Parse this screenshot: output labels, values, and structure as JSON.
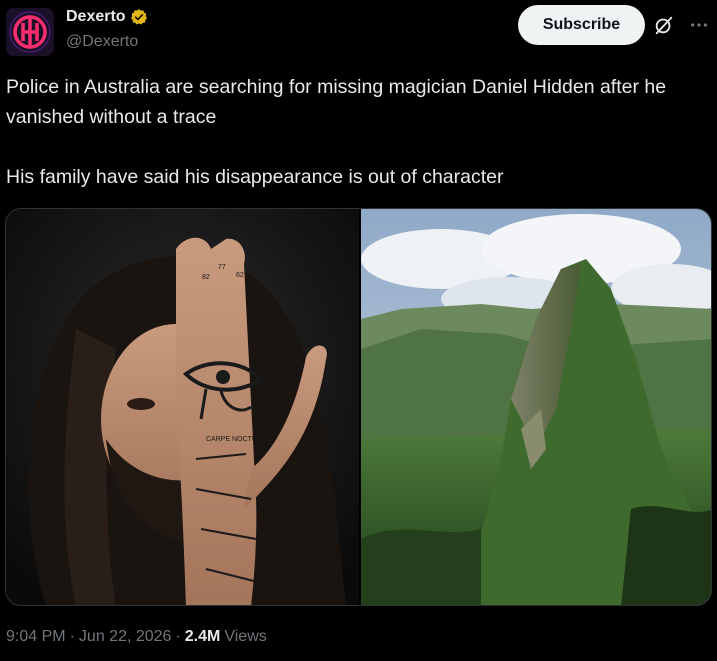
{
  "author": {
    "display_name": "Dexerto",
    "handle": "@Dexerto",
    "avatar_icon": "dexerto-logo-icon",
    "verified_icon": "verified-gold-badge-icon",
    "verified_color": "#e2b719"
  },
  "actions": {
    "subscribe_label": "Subscribe",
    "grok_icon": "grok-icon",
    "more_icon": "more-options-icon"
  },
  "tweet": {
    "text": "Police in Australia are searching for missing magician Daniel Hidden after he vanished without a trace\n\nHis family have said his disappearance is out of character"
  },
  "media": {
    "images": [
      {
        "subject": "portrait"
      },
      {
        "subject": "mountain"
      }
    ]
  },
  "meta": {
    "time": "9:04 PM",
    "sep1": "·",
    "date": "Jun 22, 2026",
    "sep2": "·",
    "views_count": "2.4M",
    "views_label": "Views"
  },
  "colors": {
    "background": "#000000",
    "text": "#e7e9ea",
    "secondary": "#71767b",
    "subscribe_bg": "#eff3f4",
    "brand_pink": "#ff2d6f"
  }
}
